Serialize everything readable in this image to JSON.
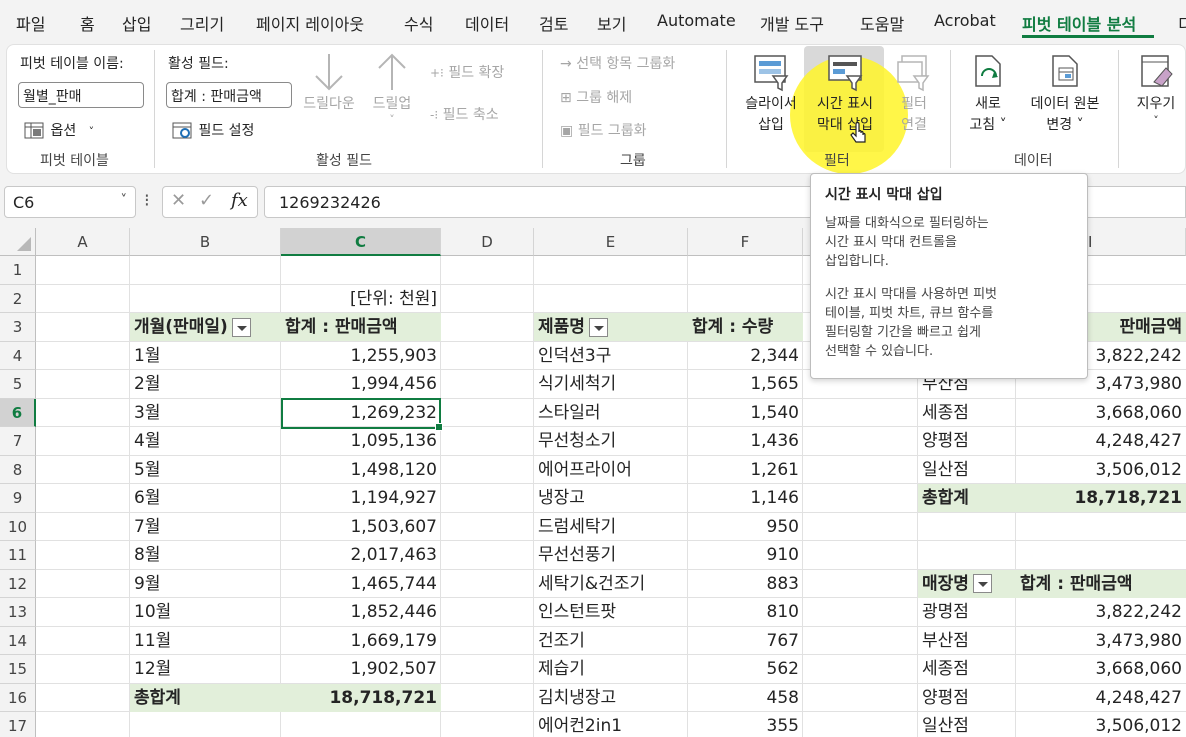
{
  "menu": {
    "tabs": [
      "파일",
      "홈",
      "삽입",
      "그리기",
      "페이지 레이아웃",
      "수식",
      "데이터",
      "검토",
      "보기",
      "Automate",
      "개발 도구",
      "도움말",
      "Acrobat",
      "피벗 테이블 분석",
      "디"
    ],
    "active_index": 13
  },
  "ribbon": {
    "pivot": {
      "name_label": "피벗 테이블 이름:",
      "name_value": "월별_판매",
      "options_label": "옵션",
      "group_label": "피벗 테이블"
    },
    "active_field": {
      "field_label": "활성 필드:",
      "field_value": "합계 : 판매금액",
      "settings_label": "필드 설정",
      "drilldown_label": "드릴다운",
      "drillup_label": "드릴업",
      "expand_label": "필드 확장",
      "collapse_label": "필드 축소",
      "group_label": "활성 필드"
    },
    "group": {
      "selection_label": "선택 항목 그룹화",
      "ungroup_label": "그룹 해제",
      "field_group_label": "필드 그룹화",
      "group_label": "그룹"
    },
    "filter": {
      "slicer_line1": "슬라이서",
      "slicer_line2": "삽입",
      "timeline_line1": "시간 표시",
      "timeline_line2": "막대 삽입",
      "connect_line1": "필터",
      "connect_line2": "연결",
      "group_label": "필터"
    },
    "data": {
      "refresh_line1": "새로",
      "refresh_line2": "고침 ˅",
      "source_line1": "데이터 원본",
      "source_line2": "변경 ˅",
      "group_label": "데이터"
    },
    "actions": {
      "clear_line1": "지우기",
      "clear_line2": "˅"
    }
  },
  "formula_bar": {
    "name_box": "C6",
    "fx": "fx",
    "value": "1269232426"
  },
  "grid": {
    "columns": [
      "A",
      "B",
      "C",
      "D",
      "E",
      "F",
      "",
      "I"
    ],
    "rows": [
      "1",
      "2",
      "3",
      "4",
      "5",
      "6",
      "7",
      "8",
      "9",
      "10",
      "11",
      "12",
      "13",
      "14",
      "15",
      "16",
      "17"
    ],
    "selected_column": "C",
    "selected_row": "6",
    "unit_note": "[단위: 천원]",
    "table1": {
      "header_a": "개월(판매일)",
      "header_b": "합계 : 판매금액",
      "rows": [
        [
          "1월",
          "1,255,903"
        ],
        [
          "2월",
          "1,994,456"
        ],
        [
          "3월",
          "1,269,232"
        ],
        [
          "4월",
          "1,095,136"
        ],
        [
          "5월",
          "1,498,120"
        ],
        [
          "6월",
          "1,194,927"
        ],
        [
          "7월",
          "1,503,607"
        ],
        [
          "8월",
          "2,017,463"
        ],
        [
          "9월",
          "1,465,744"
        ],
        [
          "10월",
          "1,852,446"
        ],
        [
          "11월",
          "1,669,179"
        ],
        [
          "12월",
          "1,902,507"
        ]
      ],
      "total_label": "총합계",
      "total_value": "18,718,721"
    },
    "table2": {
      "header_a": "제품명",
      "header_b": "합계 : 수량",
      "rows": [
        [
          "인덕션3구",
          "2,344"
        ],
        [
          "식기세척기",
          "1,565"
        ],
        [
          "스타일러",
          "1,540"
        ],
        [
          "무선청소기",
          "1,436"
        ],
        [
          "에어프라이어",
          "1,261"
        ],
        [
          "냉장고",
          "1,146"
        ],
        [
          "드럼세탁기",
          "950"
        ],
        [
          "무선선풍기",
          "910"
        ],
        [
          "세탁기&건조기",
          "883"
        ],
        [
          "인스턴트팟",
          "810"
        ],
        [
          "건조기",
          "767"
        ],
        [
          "제습기",
          "562"
        ],
        [
          "김치냉장고",
          "458"
        ],
        [
          "에어컨2in1",
          "355"
        ]
      ]
    },
    "table3": {
      "header_b": "판매금액",
      "rows": [
        [
          "",
          "3,822,242"
        ],
        [
          "부산점",
          "3,473,980"
        ],
        [
          "세종점",
          "3,668,060"
        ],
        [
          "양평점",
          "4,248,427"
        ],
        [
          "일산점",
          "3,506,012"
        ]
      ],
      "total_label": "총합계",
      "total_value": "18,718,721"
    },
    "table4": {
      "header_a": "매장명",
      "header_b": "합계 : 판매금액",
      "rows": [
        [
          "광명점",
          "3,822,242"
        ],
        [
          "부산점",
          "3,473,980"
        ],
        [
          "세종점",
          "3,668,060"
        ],
        [
          "양평점",
          "4,248,427"
        ],
        [
          "일산점",
          "3,506,012"
        ]
      ]
    }
  },
  "tooltip": {
    "title": "시간 표시 막대 삽입",
    "body1": "날짜를 대화식으로 필터링하는\n시간 표시 막대 컨트롤을\n삽입합니다.",
    "body2": "시간 표시 막대를 사용하면 피벗\n테이블, 피벗 차트, 큐브 함수를\n필터링할 기간을 빠르고 쉽게\n선택할 수 있습니다."
  },
  "colors": {
    "accent": "#107c41",
    "pivot_header": "#e2efda",
    "highlight": "#fff528"
  }
}
